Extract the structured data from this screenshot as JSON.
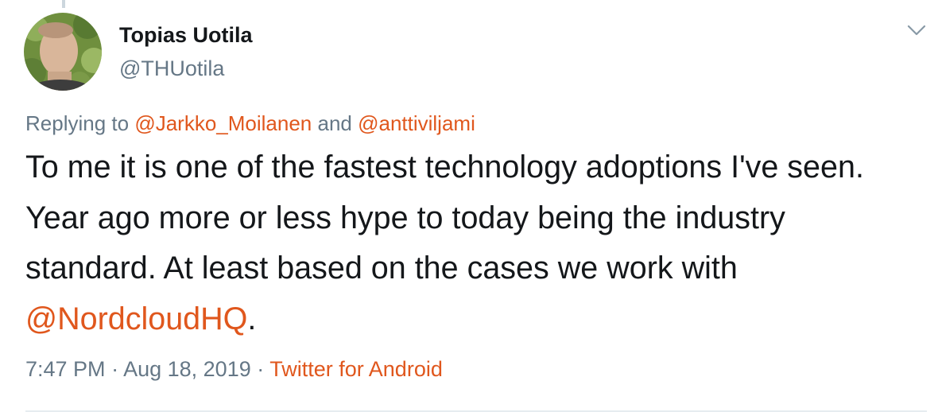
{
  "author": {
    "name": "Topias Uotila",
    "handle": "@THUotila"
  },
  "reply": {
    "prefix": "Replying to ",
    "mention1": "@Jarkko_Moilanen",
    "joiner": " and ",
    "mention2": "@anttiviljami"
  },
  "tweet": {
    "text_before": "To me it is one of the fastest technology adoptions I've seen. Year ago more or less hype to today being the industry standard. At least based on the cases we work with ",
    "mention": "@NordcloudHQ",
    "text_after": "."
  },
  "meta": {
    "time": "7:47 PM",
    "separator": " · ",
    "date": "Aug 18, 2019",
    "source": "Twitter for Android"
  },
  "icons": {
    "menu": "chevron-down-icon"
  },
  "colors": {
    "link": "#e0571d",
    "muted": "#657786",
    "text": "#14171a"
  }
}
